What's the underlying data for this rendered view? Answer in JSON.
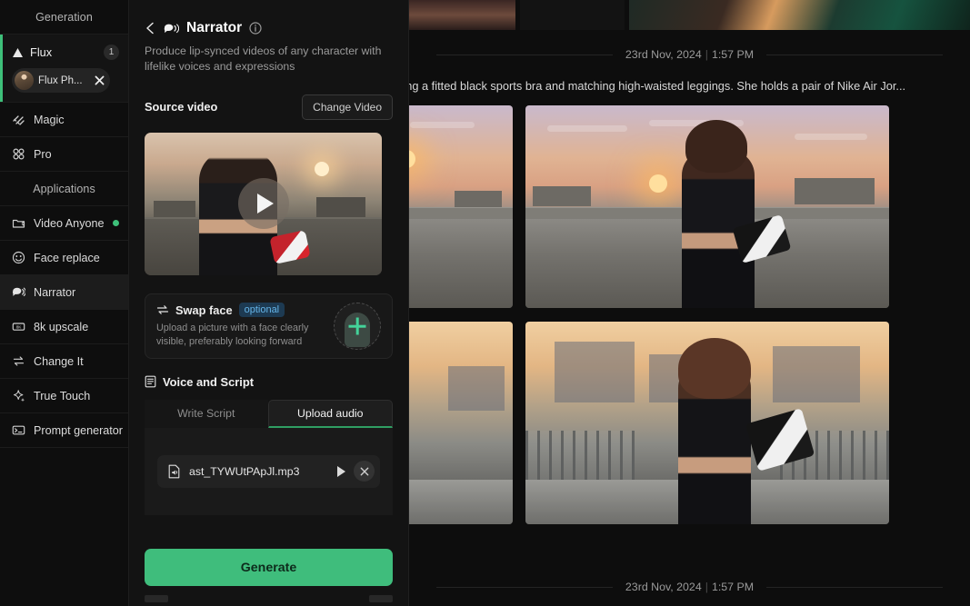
{
  "sidebar": {
    "generation_title": "Generation",
    "model": {
      "name": "Flux",
      "count": "1",
      "icon": "triangle-icon"
    },
    "chip": {
      "label": "Flux Ph...",
      "close_icon": "close-icon"
    },
    "extra_items": [
      {
        "label": "Magic",
        "icon": "sparkle-icon"
      },
      {
        "label": "Pro",
        "icon": "grid-dots-icon"
      }
    ],
    "applications_title": "Applications",
    "items": [
      {
        "label": "Video Anyone",
        "icon": "video-folder-icon",
        "status_dot": "#3ec07a",
        "active": false
      },
      {
        "label": "Face replace",
        "icon": "smiley-face-icon",
        "active": false
      },
      {
        "label": "Narrator",
        "icon": "speech-voice-icon",
        "active": true
      },
      {
        "label": "8k upscale",
        "icon": "upscale-8k-icon",
        "active": false
      },
      {
        "label": "Change It",
        "icon": "swap-arrows-icon",
        "active": false
      },
      {
        "label": "True Touch",
        "icon": "sparkle-star-icon",
        "active": false
      },
      {
        "label": "Prompt generator",
        "icon": "terminal-icon",
        "active": false
      }
    ]
  },
  "panel": {
    "back_icon": "back-chevron-icon",
    "title_icon": "speech-voice-icon",
    "title": "Narrator",
    "info_icon": "info-icon",
    "subtitle": "Produce lip-synced videos of any character with lifelike voices and expressions",
    "source_video_label": "Source video",
    "change_video_button": "Change Video",
    "play_icon": "play-icon",
    "swap_face": {
      "icon": "swap-arrows-icon",
      "title": "Swap face",
      "badge": "optional",
      "description": "Upload a picture with a face clearly visible, preferably looking forward",
      "avatar_icon": "add-face-plus-icon"
    },
    "voice_script": {
      "icon": "script-icon",
      "title": "Voice and Script",
      "tabs": [
        {
          "label": "Write Script",
          "active": false
        },
        {
          "label": "Upload audio",
          "active": true
        }
      ],
      "audio_file": {
        "icon": "audio-file-icon",
        "name": "ast_TYWUtPApJl.mp3",
        "play_icon": "play-icon",
        "remove_icon": "close-circle-icon"
      }
    },
    "generate_button": "Generate"
  },
  "main": {
    "divider_top": {
      "date": "23rd Nov, 2024",
      "separator": "|",
      "time": "1:57 PM"
    },
    "prompt_text": "aring a fitted black sports bra and matching high-waisted leggings. She holds a pair of Nike Air Jor...",
    "divider_bottom": {
      "date": "23rd Nov, 2024",
      "separator": "|",
      "time": "1:57 PM"
    },
    "gallery": [
      {
        "name": "rooftop-sunset-thumb-left",
        "alt": "Rooftop sunset partial"
      },
      {
        "name": "rooftop-sunset-main",
        "alt": "Woman on rooftop at sunset holding sneakers"
      },
      {
        "name": "bridge-sunset-thumb-left",
        "alt": "Bridge sunset partial"
      },
      {
        "name": "bridge-sunset-main",
        "alt": "Woman on bridge holding Air Jordan sneakers"
      }
    ]
  },
  "colors": {
    "accent_green": "#3fbd7c",
    "badge_blue": "#64b4e8",
    "panel_bg": "#131313",
    "sidebar_bg": "#0e0e0e"
  }
}
